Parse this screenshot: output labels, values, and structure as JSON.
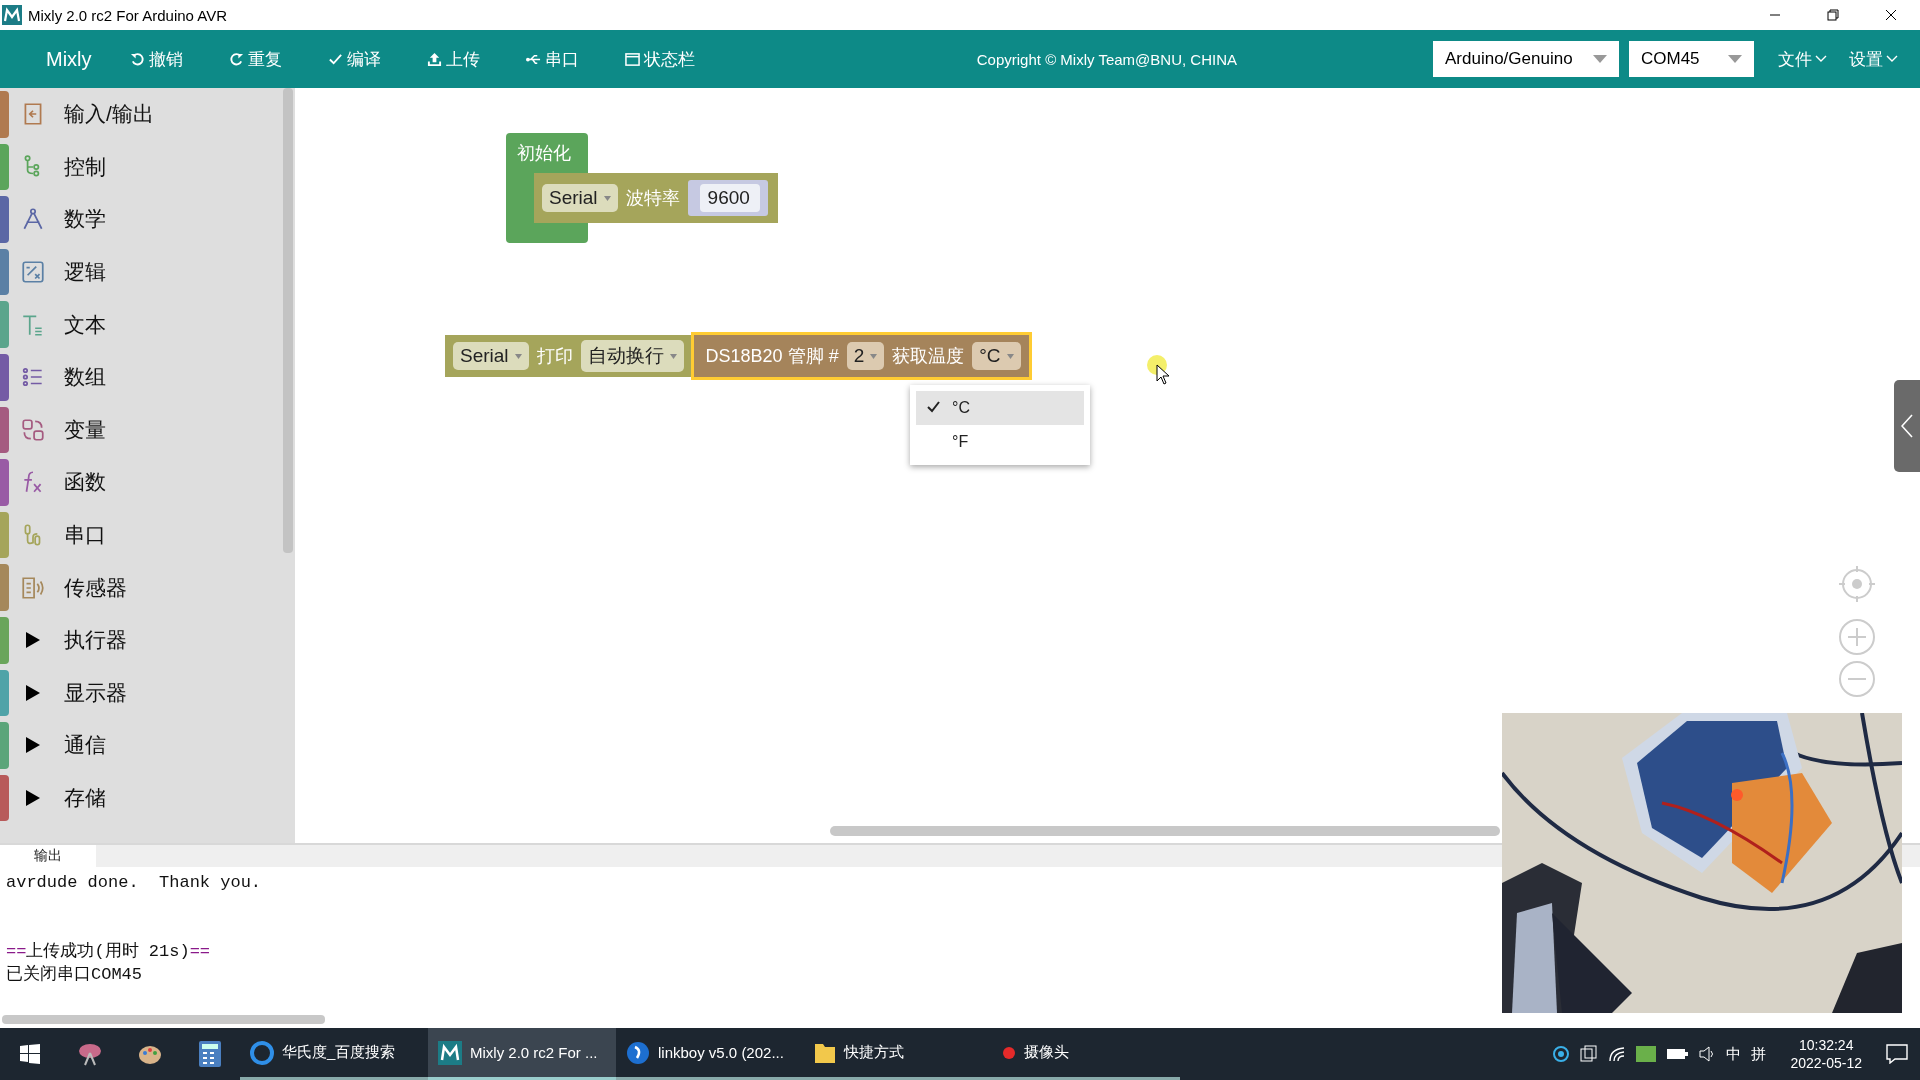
{
  "window": {
    "title": "Mixly 2.0 rc2 For Arduino AVR"
  },
  "toolbar": {
    "brand": "Mixly",
    "actions": [
      {
        "label": "撤销",
        "kind": "undo"
      },
      {
        "label": "重复",
        "kind": "redo"
      },
      {
        "label": "编译",
        "kind": "check"
      },
      {
        "label": "上传",
        "kind": "upload"
      },
      {
        "label": "串口",
        "kind": "usb"
      },
      {
        "label": "状态栏",
        "kind": "panel"
      }
    ],
    "copyright": "Copyright © Mixly Team@BNU, CHINA",
    "board": "Arduino/Genuino",
    "port": "COM45",
    "menus": [
      "文件",
      "设置"
    ]
  },
  "sidebar": {
    "items": [
      {
        "label": "输入/输出",
        "color": "#b07a50",
        "expandable": false
      },
      {
        "label": "控制",
        "color": "#5ba55b",
        "expandable": false
      },
      {
        "label": "数学",
        "color": "#5b67a5",
        "expandable": false
      },
      {
        "label": "逻辑",
        "color": "#5b80a5",
        "expandable": false
      },
      {
        "label": "文本",
        "color": "#5ba58c",
        "expandable": false
      },
      {
        "label": "数组",
        "color": "#745ba5",
        "expandable": false
      },
      {
        "label": "变量",
        "color": "#a55b80",
        "expandable": false
      },
      {
        "label": "函数",
        "color": "#995ba5",
        "expandable": false
      },
      {
        "label": "串口",
        "color": "#a5a55b",
        "expandable": false
      },
      {
        "label": "传感器",
        "color": "#a5885b",
        "expandable": false
      },
      {
        "label": "执行器",
        "color": "#6aa55b",
        "expandable": true
      },
      {
        "label": "显示器",
        "color": "#4fa3a8",
        "expandable": true
      },
      {
        "label": "通信",
        "color": "#5ba57a",
        "expandable": true
      },
      {
        "label": "存储",
        "color": "#b85a5a",
        "expandable": true
      }
    ]
  },
  "workspace": {
    "init_block": {
      "title": "初始化",
      "serial": "Serial",
      "label": "波特率",
      "value": "9600"
    },
    "print_block": {
      "serial": "Serial",
      "label": "打印",
      "mode": "自动换行",
      "sensor": {
        "name": "DS18B20 管脚 #",
        "pin": "2",
        "label": "获取温度",
        "unit": "°C",
        "selected": true
      }
    },
    "unit_menu": {
      "options": [
        {
          "label": "°C",
          "selected": true
        },
        {
          "label": "°F",
          "selected": false
        }
      ]
    }
  },
  "output": {
    "tab": "输出",
    "lines": [
      {
        "kind": "plain",
        "text": "avrdude done.  Thank you."
      },
      {
        "kind": "banner",
        "open": "==",
        "text": "上传成功(用时 21s)",
        "close": "=="
      },
      {
        "kind": "plain",
        "text": "已关闭串口COM45"
      }
    ]
  },
  "taskbar": {
    "tasks": [
      {
        "label": "华氏度_百度搜索",
        "selected": false
      },
      {
        "label": "Mixly 2.0 rc2 For ...",
        "selected": true
      },
      {
        "label": "linkboy v5.0 (202...",
        "selected": false
      },
      {
        "label": "快捷方式",
        "selected": false
      },
      {
        "label": "摄像头",
        "selected": false
      }
    ],
    "ime": "中",
    "layout": "拼",
    "time": "10:32:24",
    "date": "2022-05-12"
  }
}
